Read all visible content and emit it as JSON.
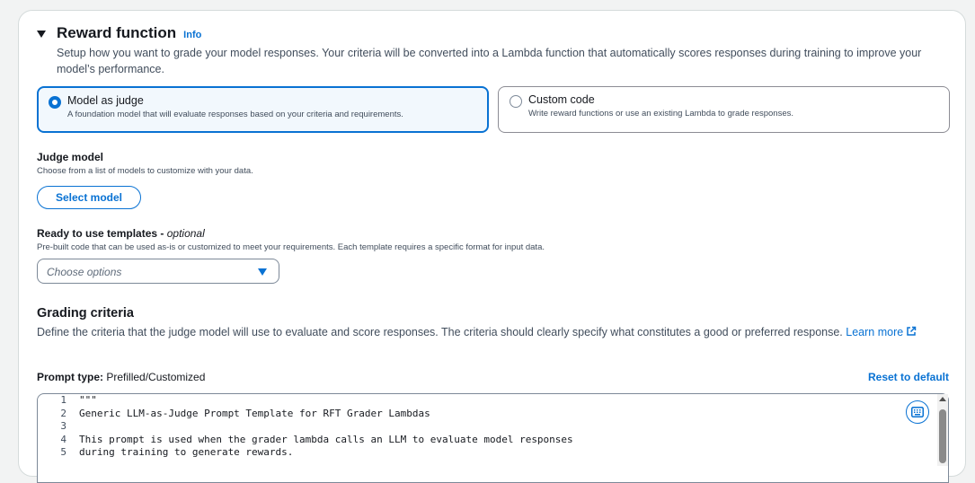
{
  "section": {
    "title": "Reward function",
    "info_label": "Info",
    "description": "Setup how you want to grade your model responses. Your criteria will be converted into a Lambda function that automatically scores responses during training to improve your model’s performance."
  },
  "reward_options": [
    {
      "label": "Model as judge",
      "description": "A foundation model that will evaluate responses based on your criteria and requirements.",
      "selected": true
    },
    {
      "label": "Custom code",
      "description": "Write reward functions or use an existing Lambda to grade responses.",
      "selected": false
    }
  ],
  "judge_model": {
    "label": "Judge model",
    "description": "Choose from a list of models to customize with your data.",
    "button_label": "Select model"
  },
  "templates": {
    "label": "Ready to use templates - ",
    "optional_label": "optional",
    "description": "Pre-built code that can be used as-is or customized to meet your requirements. Each template requires a specific format for input data.",
    "placeholder": "Choose options"
  },
  "grading": {
    "title": "Grading criteria",
    "description": "Define the criteria that the judge model will use to evaluate and score responses. The criteria should clearly specify what constitutes a good or preferred response. ",
    "learn_more": "Learn more",
    "prompt_type_label": "Prompt type:",
    "prompt_type_value": " Prefilled/Customized",
    "reset_label": "Reset to default"
  },
  "editor": {
    "lines": [
      {
        "n": "1",
        "code": "\"\"\""
      },
      {
        "n": "2",
        "code": "Generic LLM-as-Judge Prompt Template for RFT Grader Lambdas"
      },
      {
        "n": "3",
        "code": ""
      },
      {
        "n": "4",
        "code": "This prompt is used when the grader lambda calls an LLM to evaluate model responses"
      },
      {
        "n": "5",
        "code": "during training to generate rewards."
      }
    ]
  },
  "colors": {
    "accent": "#0972d3",
    "text": "#16191f",
    "muted": "#414d5c",
    "selected_bg": "#f2f8fd"
  }
}
